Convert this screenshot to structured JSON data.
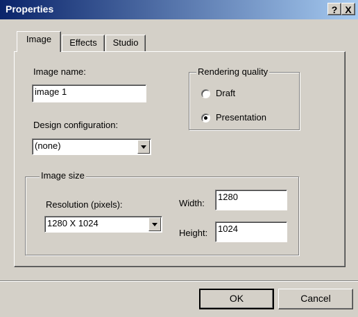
{
  "window": {
    "title": "Properties",
    "help_label": "?",
    "close_label": "X"
  },
  "tabs": [
    {
      "label": "Image",
      "active": true
    },
    {
      "label": "Effects",
      "active": false
    },
    {
      "label": "Studio",
      "active": false
    }
  ],
  "image_tab": {
    "image_name_label": "Image name:",
    "image_name_value": "image 1",
    "design_config_label": "Design configuration:",
    "design_config_value": "(none)",
    "rendering_quality": {
      "legend": "Rendering quality",
      "options": [
        {
          "label": "Draft",
          "selected": false
        },
        {
          "label": "Presentation",
          "selected": true
        }
      ]
    },
    "image_size": {
      "legend": "Image size",
      "resolution_label": "Resolution (pixels):",
      "resolution_value": "1280 X 1024",
      "width_label": "Width:",
      "width_value": "1280",
      "height_label": "Height:",
      "height_value": "1024"
    }
  },
  "buttons": {
    "ok_label": "OK",
    "cancel_label": "Cancel"
  }
}
